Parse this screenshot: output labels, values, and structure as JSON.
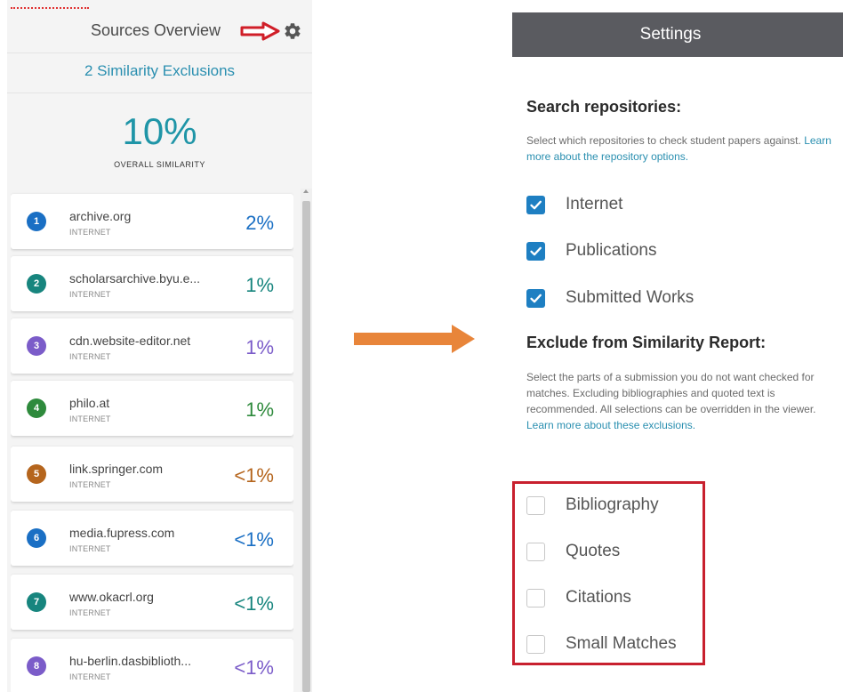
{
  "left_panel": {
    "title": "Sources Overview",
    "exclusions_link": "2 Similarity Exclusions",
    "overall_similarity": "10%",
    "overall_label": "OVERALL SIMILARITY",
    "sources": [
      {
        "number": "1",
        "name": "archive.org",
        "type": "INTERNET",
        "percent": "2%",
        "color": "#1a6fc4"
      },
      {
        "number": "2",
        "name": "scholarsarchive.byu.e...",
        "type": "INTERNET",
        "percent": "1%",
        "color": "#17857e"
      },
      {
        "number": "3",
        "name": "cdn.website-editor.net",
        "type": "INTERNET",
        "percent": "1%",
        "color": "#7b5cc9"
      },
      {
        "number": "4",
        "name": "philo.at",
        "type": "INTERNET",
        "percent": "1%",
        "color": "#2e8a3c"
      },
      {
        "number": "5",
        "name": "link.springer.com",
        "type": "INTERNET",
        "percent": "<1%",
        "color": "#b5651d"
      },
      {
        "number": "6",
        "name": "media.fupress.com",
        "type": "INTERNET",
        "percent": "<1%",
        "color": "#1a6fc4"
      },
      {
        "number": "7",
        "name": "www.okacrl.org",
        "type": "INTERNET",
        "percent": "<1%",
        "color": "#17857e"
      },
      {
        "number": "8",
        "name": "hu-berlin.dasbiblioth...",
        "type": "INTERNET",
        "percent": "<1%",
        "color": "#7b5cc9"
      }
    ]
  },
  "settings": {
    "header": "Settings",
    "repositories": {
      "title": "Search repositories:",
      "desc": "Select which repositories to check student papers against.",
      "link": "Learn more about the repository options.",
      "options": [
        {
          "label": "Internet",
          "checked": true
        },
        {
          "label": "Publications",
          "checked": true
        },
        {
          "label": "Submitted Works",
          "checked": true
        }
      ]
    },
    "exclude": {
      "title": "Exclude from Similarity Report:",
      "desc": "Select the parts of a submission you do not want checked for matches. Excluding bibliographies and quoted text is recommended. All selections can be overridden in the viewer.",
      "link": "Learn more about these exclusions.",
      "options": [
        {
          "label": "Bibliography",
          "checked": false
        },
        {
          "label": "Quotes",
          "checked": false
        },
        {
          "label": "Citations",
          "checked": false
        },
        {
          "label": "Small Matches",
          "checked": false
        }
      ]
    }
  },
  "colors": {
    "accent_teal": "#1f95a7",
    "link": "#2a8fb0",
    "checkbox": "#1e7fc2",
    "header_bg": "#5a5b60",
    "annotation_red": "#c8202e",
    "arrow_orange": "#e8853a"
  }
}
